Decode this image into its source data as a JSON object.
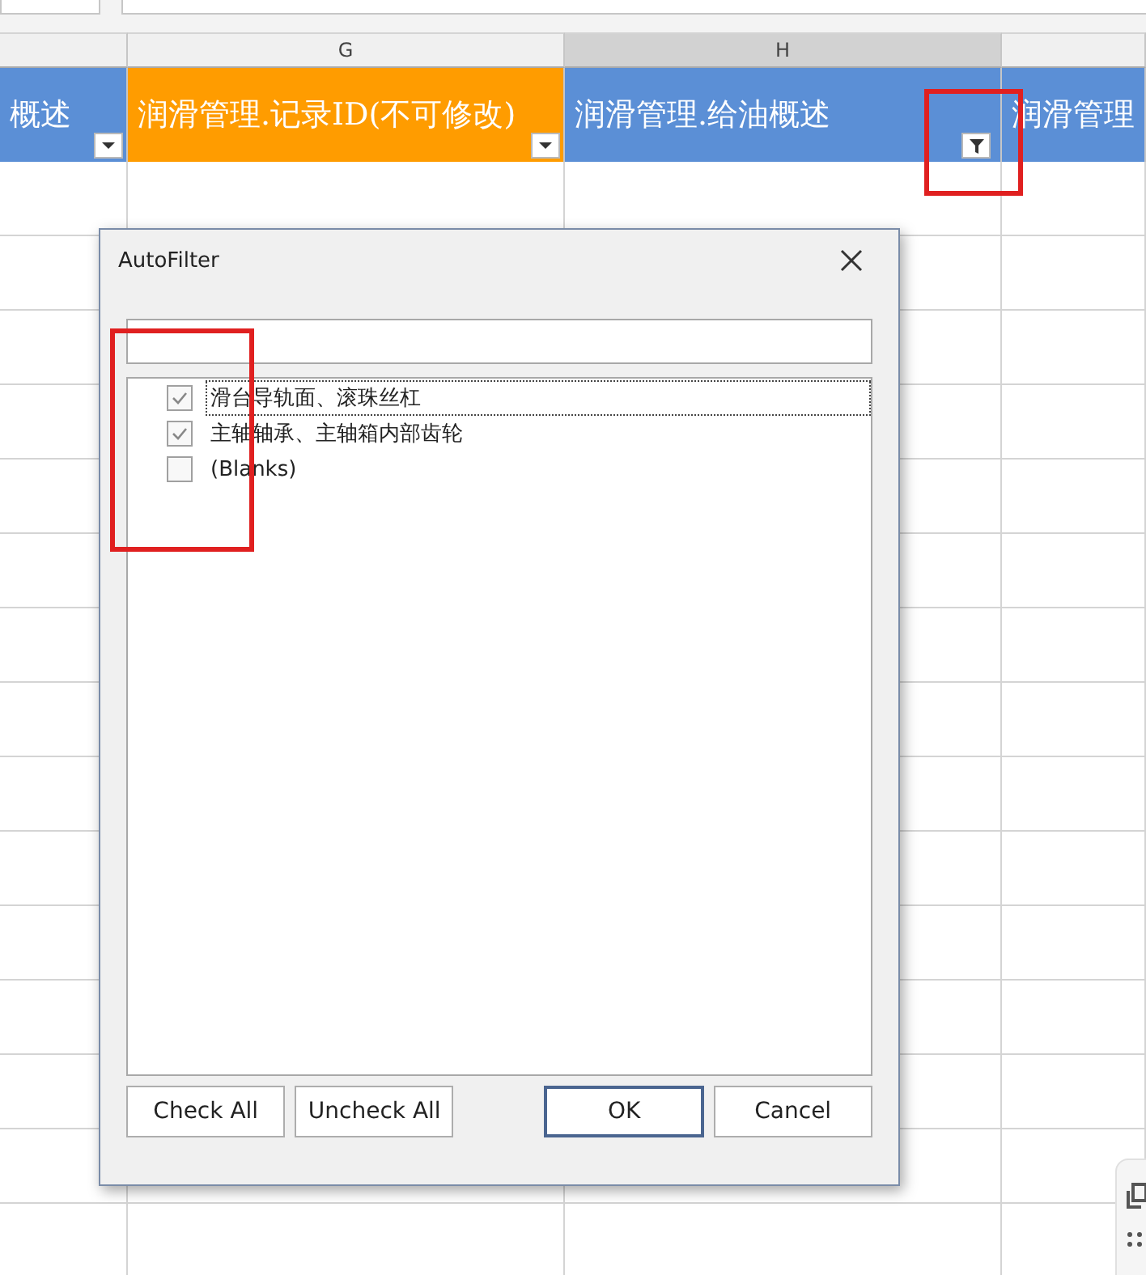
{
  "columns": [
    {
      "header": "概述",
      "color": "#5b8fd6",
      "kind": "arrow",
      "selected": false
    },
    {
      "letter": "G",
      "header": "润滑管理.记录ID(不可修改)",
      "color": "#ff9c00",
      "kind": "arrow",
      "selected": false
    },
    {
      "letter": "H",
      "header": "润滑管理.给油概述",
      "color": "#5b8fd6",
      "kind": "funnel",
      "selected": true
    },
    {
      "header": "润滑管理",
      "color": "#5b8fd6",
      "kind": "plain",
      "selected": false
    }
  ],
  "dialog": {
    "title": "AutoFilter",
    "items": [
      {
        "label": "滑台导轨面、滚珠丝杠",
        "checked": true,
        "selected": true
      },
      {
        "label": "主轴轴承、主轴箱内部齿轮",
        "checked": true,
        "selected": false
      },
      {
        "label": "(Blanks)",
        "checked": false,
        "selected": false
      }
    ],
    "buttons": [
      {
        "label": "Check All",
        "default": false
      },
      {
        "label": "Uncheck All",
        "default": false
      },
      {
        "label": "OK",
        "default": true
      },
      {
        "label": "Cancel",
        "default": false
      }
    ]
  }
}
